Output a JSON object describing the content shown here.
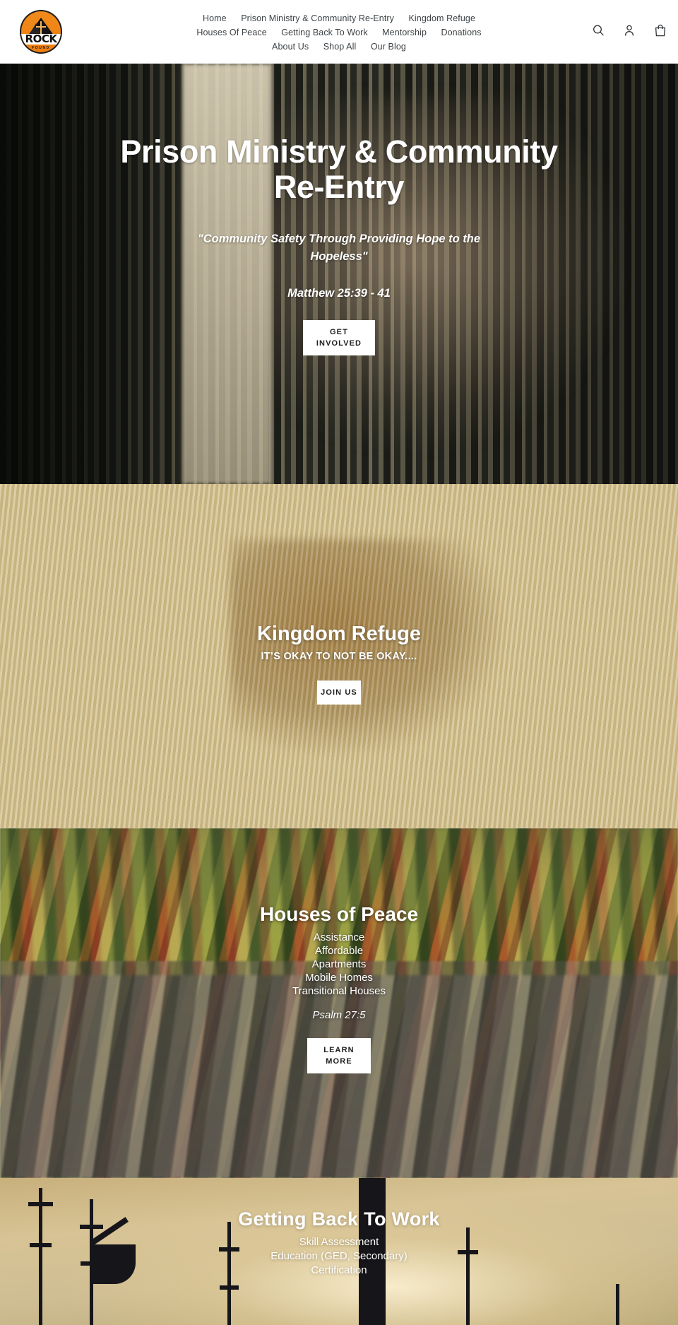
{
  "header": {
    "logo": {
      "name": "rock-found-logo",
      "word": "ROCK",
      "subword": "FOUND"
    },
    "nav_rows": [
      [
        {
          "label": "Home"
        },
        {
          "label": "Prison Ministry & Community Re-Entry"
        },
        {
          "label": "Kingdom Refuge"
        }
      ],
      [
        {
          "label": "Houses Of Peace"
        },
        {
          "label": "Getting Back To Work"
        },
        {
          "label": "Mentorship"
        },
        {
          "label": "Donations"
        }
      ],
      [
        {
          "label": "About Us"
        },
        {
          "label": "Shop All"
        },
        {
          "label": "Our Blog"
        }
      ]
    ],
    "icons": [
      {
        "name": "search-icon"
      },
      {
        "name": "account-icon"
      },
      {
        "name": "cart-icon"
      }
    ]
  },
  "slides": {
    "prison": {
      "title": "Prison Ministry & Community Re-Entry",
      "subtitle": "\"Community Safety Through Providing Hope to the Hopeless\"",
      "verse": "Matthew 25:39 - 41",
      "button": "GET INVOLVED"
    },
    "refuge": {
      "title": "Kingdom Refuge",
      "subtitle": "IT’S OKAY TO NOT BE OKAY....",
      "button": "JOIN US"
    },
    "houses": {
      "title": "Houses of Peace",
      "items": [
        "Assistance",
        "Affordable",
        "Apartments",
        "Mobile Homes",
        "Transitional Houses"
      ],
      "verse": "Psalm 27:5",
      "button": "LEARN MORE"
    },
    "work": {
      "title": "Getting Back To Work",
      "items": [
        "Skill Assessment",
        "Education (GED, Secondary)",
        "Certification"
      ]
    }
  },
  "colors": {
    "brand_orange": "#ef8417",
    "nav_text": "#3d4246",
    "button_bg": "#ffffff",
    "button_text": "#1d1d1d",
    "slide_text": "#ffffff"
  }
}
